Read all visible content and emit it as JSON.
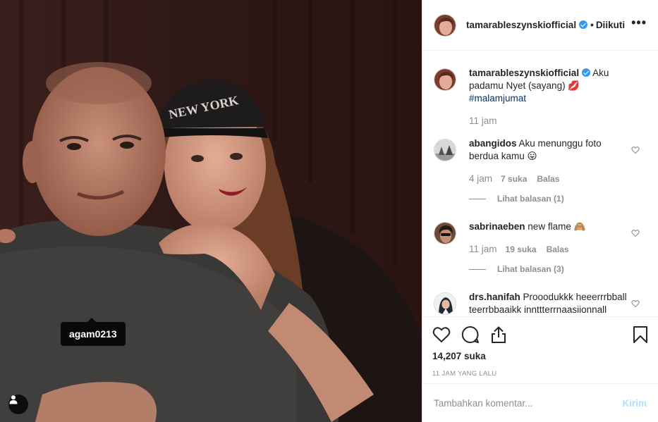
{
  "post": {
    "tagged_user": "agam0213"
  },
  "header": {
    "username": "tamarableszynskiofficial",
    "separator": "•",
    "follow_label": "Diikuti",
    "more_label": "•••"
  },
  "caption": {
    "username": "tamarableszynskiofficial",
    "text": "Aku padamu Nyet (sayang) 💋",
    "hashtag": "#malamjumat",
    "time": "11 jam"
  },
  "comments": [
    {
      "username": "abangidos",
      "text": "Aku menunggu foto berdua kamu 😛",
      "time": "4 jam",
      "likes": "7 suka",
      "reply_label": "Balas",
      "replies_label": "Lihat balasan (1)"
    },
    {
      "username": "sabrinaeben",
      "text": "new flame 🙈",
      "time": "11 jam",
      "likes": "19 suka",
      "reply_label": "Balas",
      "replies_label": "Lihat balasan (3)"
    },
    {
      "username": "drs.hanifah",
      "text": "Prooodukkk heeerrrbball teerrbbaaikk innttterrnaasiionnall"
    }
  ],
  "actions": {
    "likes": "14,207 suka",
    "timestamp": "11 JAM YANG LALU"
  },
  "composer": {
    "placeholder": "Tambahkan komentar...",
    "post_label": "Kirim"
  },
  "colors": {
    "link": "#003569",
    "verified": "#3897f0",
    "post_button_disabled": "#b2dffc",
    "muted": "#8e8e8e"
  }
}
